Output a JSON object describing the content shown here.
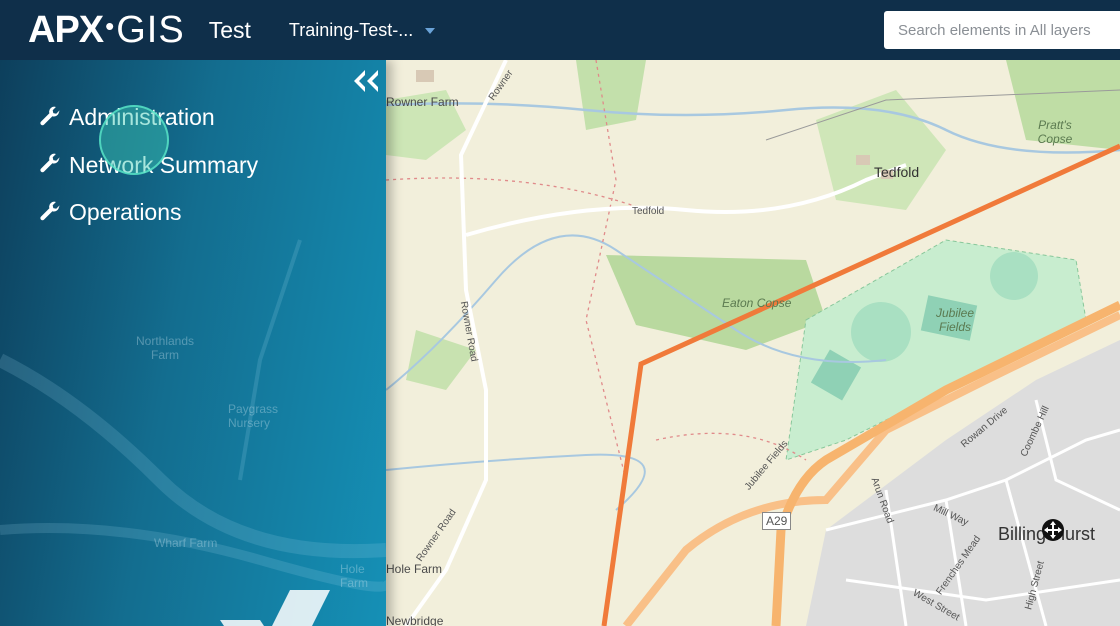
{
  "header": {
    "logo_apx": "APX",
    "logo_gis": "GIS",
    "app_title": "Test",
    "project": "Training-Test-...",
    "search_placeholder": "Search elements in All layers"
  },
  "sidebar": {
    "collapse_icon": "double-chevron-left-icon",
    "items": [
      {
        "label": "Administration",
        "icon": "wrench-icon"
      },
      {
        "label": "Network Summary",
        "icon": "wrench-icon"
      },
      {
        "label": "Operations",
        "icon": "wrench-icon"
      }
    ],
    "ghost_labels": [
      "Northlands Farm",
      "Paygrass Nursery",
      "Wharf Farm",
      "Hole Farm"
    ]
  },
  "map": {
    "labels": {
      "owner_farm": "Rowner Farm",
      "rowner_top": "Rowner",
      "tedfold_road": "Tedfold",
      "tedfold_place": "Tedfold",
      "pratts_copse": "Pratt's Copse",
      "eaton_copse": "Eaton Copse",
      "jubilee_fields": "Jubilee Fields",
      "rowner_road": "Rowner Road",
      "rowner_road_2": "Rowner Road",
      "jubilee_fields_road": "Jubilee Fields",
      "a29": "A29",
      "rowan_drive": "Rowan Drive",
      "coombe_hill": "Coombe Hill",
      "mill_way": "Mill Way",
      "arun_road": "Arun Road",
      "frenches_mead": "Frenches Mead",
      "west_street": "West Street",
      "high_street": "High Street",
      "billingshurst": "Billingshurst",
      "hole_farm": "Hole Farm",
      "newbridge": "Newbridge"
    },
    "boundary_color": "#f07a3a",
    "move_icon": "move-crosshair-icon"
  }
}
